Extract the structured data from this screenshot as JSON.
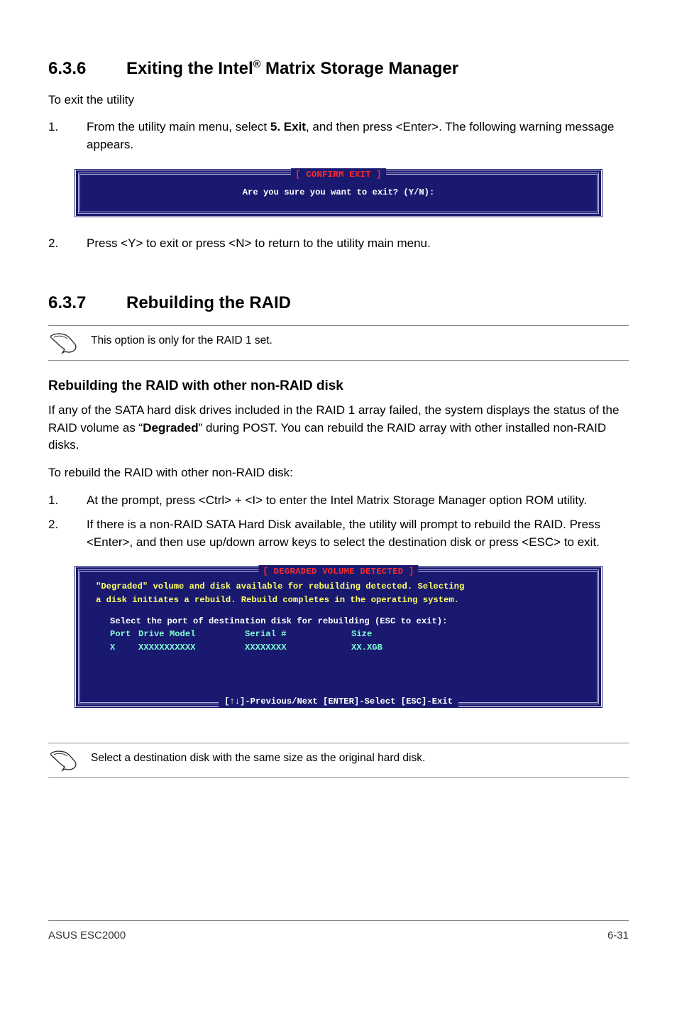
{
  "section636": {
    "number": "6.3.6",
    "title_pre": "Exiting the Intel",
    "title_sup": "®",
    "title_post": " Matrix Storage Manager",
    "intro": "To exit the utility",
    "step1_num": "1.",
    "step1_text_a": "From the utility main menu, select ",
    "step1_bold": "5. Exit",
    "step1_text_b": ", and then press <Enter>. The following warning message appears.",
    "term_legend": "[ CONFIRM EXIT ]",
    "term_line": "Are you sure you want to exit? (Y/N):",
    "step2_num": "2.",
    "step2_text": "Press <Y> to exit or press <N> to return to the utility main menu."
  },
  "section637": {
    "number": "6.3.7",
    "title": "Rebuilding the RAID",
    "note": "This option is only for the RAID 1 set.",
    "subheading": "Rebuilding the RAID with other non-RAID disk",
    "para1_a": "If any of the SATA hard disk drives included in the RAID 1 array failed, the system displays the status of the RAID volume as “",
    "para1_bold": "Degraded",
    "para1_b": "” during POST. You can rebuild the RAID array with other installed non-RAID disks.",
    "para2": "To rebuild the RAID with other non-RAID disk:",
    "step1_num": "1.",
    "step1_text": "At the prompt, press <Ctrl> + <I> to enter the Intel Matrix Storage Manager option ROM utility.",
    "step2_num": "2.",
    "step2_text": "If there is a non-RAID SATA Hard Disk available, the utility will prompt to rebuild the RAID. Press <Enter>, and then use up/down arrow keys to select the destination disk or press <ESC> to exit.",
    "term_legend": "[ DEGRADED VOLUME DETECTED ]",
    "term_l1": "\"Degraded\" volume and disk available for rebuilding detected. Selecting",
    "term_l2": "a disk initiates a rebuild. Rebuild completes in the operating system.",
    "term_l3": "Select the port of destination disk for rebuilding (ESC to exit):",
    "term_h_port": "Port",
    "term_h_drive": "Drive Model",
    "term_h_serial": "Serial #",
    "term_h_size": "Size",
    "term_d_port": "X",
    "term_d_drive": "XXXXXXXXXXX",
    "term_d_serial": "XXXXXXXX",
    "term_d_size": "XX.XGB",
    "term_footer": "[↑↓]-Previous/Next  [ENTER]-Select  [ESC]-Exit",
    "note2": "Select a destination disk with the same size as the original hard disk."
  },
  "footer": {
    "left": "ASUS ESC2000",
    "right": "6-31"
  }
}
